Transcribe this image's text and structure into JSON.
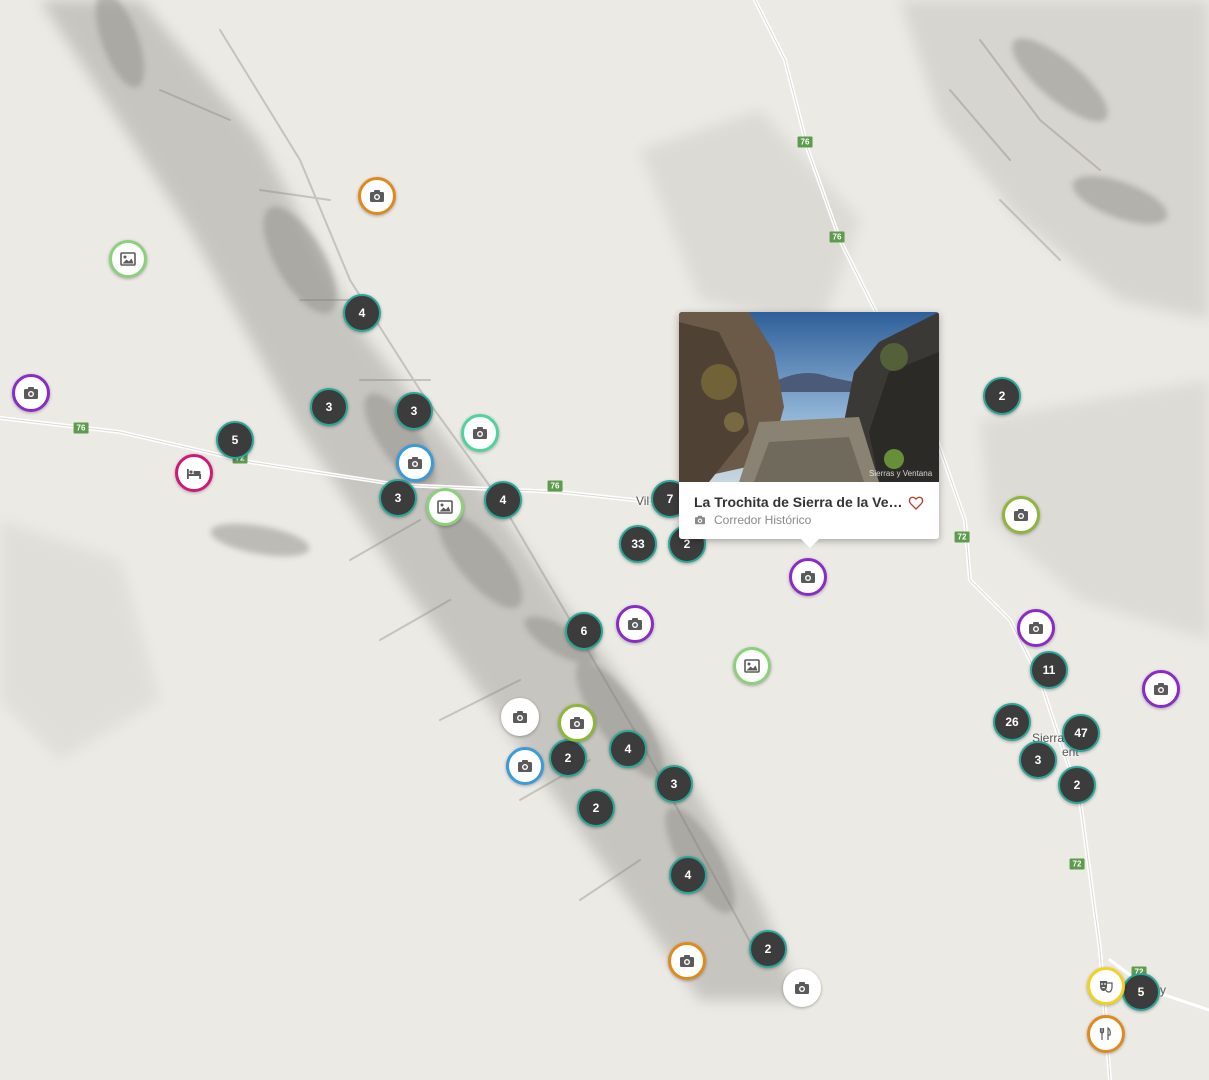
{
  "colors": {
    "cluster_bg": "#3c3c3c",
    "cluster_border": "#2aa79a",
    "road_shield": "#5e9c4d",
    "purple": "#8a2bc8",
    "orange": "#e08a1e",
    "light_green": "#8bd17a",
    "mint": "#4dd49a",
    "olive": "#8fb53a",
    "blue": "#3a9bdc",
    "magenta": "#d0187a",
    "yellow": "#f2d21e",
    "white": "#ffffff"
  },
  "road_labels": [
    "76",
    "76",
    "76",
    "76",
    "72",
    "72",
    "72",
    "72"
  ],
  "place_labels": [
    "Vil",
    "Sierra",
    "ent",
    "y"
  ],
  "clusters": [
    "4",
    "3",
    "3",
    "5",
    "3",
    "4",
    "7",
    "33",
    "2",
    "6",
    "2",
    "4",
    "3",
    "2",
    "4",
    "2",
    "2",
    "11",
    "26",
    "47",
    "3",
    "2",
    "5"
  ],
  "pois": [
    {
      "icon": "camera-icon",
      "color": "#e08a1e"
    },
    {
      "icon": "photo-icon",
      "color": "#8bd17a"
    },
    {
      "icon": "camera-icon",
      "color": "#8a2bc8"
    },
    {
      "icon": "bed-icon",
      "color": "#d0187a"
    },
    {
      "icon": "camera-icon",
      "color": "#4dd49a"
    },
    {
      "icon": "camera-icon",
      "color": "#3a9bdc"
    },
    {
      "icon": "photo-icon",
      "color": "#8bd17a"
    },
    {
      "icon": "camera-icon",
      "color": "#8a2bc8"
    },
    {
      "icon": "photo-icon",
      "color": "#8bd17a"
    },
    {
      "icon": "camera-icon",
      "color": "#ffffff"
    },
    {
      "icon": "camera-icon",
      "color": "#8fb53a"
    },
    {
      "icon": "camera-icon",
      "color": "#3a9bdc"
    },
    {
      "icon": "camera-icon",
      "color": "#8a2bc8"
    },
    {
      "icon": "camera-icon",
      "color": "#8fb53a"
    },
    {
      "icon": "camera-icon",
      "color": "#8a2bc8"
    },
    {
      "icon": "camera-icon",
      "color": "#8a2bc8"
    },
    {
      "icon": "camera-icon",
      "color": "#e08a1e"
    },
    {
      "icon": "camera-icon",
      "color": "#ffffff"
    },
    {
      "icon": "theater-icon",
      "color": "#f2d21e"
    },
    {
      "icon": "cutlery-icon",
      "color": "#e08a1e"
    }
  ],
  "popup": {
    "title": "La Trochita de Sierra de la Vent...",
    "category": "Corredor Histórico",
    "category_icon": "camera-icon",
    "favorite_icon": "heart-icon",
    "photo_watermark": "Sierras y Ventana"
  }
}
